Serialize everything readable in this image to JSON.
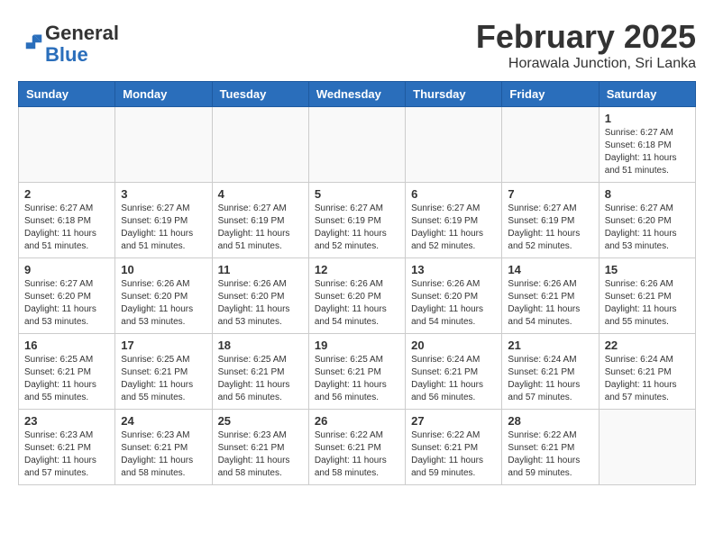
{
  "header": {
    "logo_general": "General",
    "logo_blue": "Blue",
    "title": "February 2025",
    "subtitle": "Horawala Junction, Sri Lanka"
  },
  "weekdays": [
    "Sunday",
    "Monday",
    "Tuesday",
    "Wednesday",
    "Thursday",
    "Friday",
    "Saturday"
  ],
  "weeks": [
    [
      {
        "day": "",
        "info": ""
      },
      {
        "day": "",
        "info": ""
      },
      {
        "day": "",
        "info": ""
      },
      {
        "day": "",
        "info": ""
      },
      {
        "day": "",
        "info": ""
      },
      {
        "day": "",
        "info": ""
      },
      {
        "day": "1",
        "info": "Sunrise: 6:27 AM\nSunset: 6:18 PM\nDaylight: 11 hours\nand 51 minutes."
      }
    ],
    [
      {
        "day": "2",
        "info": "Sunrise: 6:27 AM\nSunset: 6:18 PM\nDaylight: 11 hours\nand 51 minutes."
      },
      {
        "day": "3",
        "info": "Sunrise: 6:27 AM\nSunset: 6:19 PM\nDaylight: 11 hours\nand 51 minutes."
      },
      {
        "day": "4",
        "info": "Sunrise: 6:27 AM\nSunset: 6:19 PM\nDaylight: 11 hours\nand 51 minutes."
      },
      {
        "day": "5",
        "info": "Sunrise: 6:27 AM\nSunset: 6:19 PM\nDaylight: 11 hours\nand 52 minutes."
      },
      {
        "day": "6",
        "info": "Sunrise: 6:27 AM\nSunset: 6:19 PM\nDaylight: 11 hours\nand 52 minutes."
      },
      {
        "day": "7",
        "info": "Sunrise: 6:27 AM\nSunset: 6:19 PM\nDaylight: 11 hours\nand 52 minutes."
      },
      {
        "day": "8",
        "info": "Sunrise: 6:27 AM\nSunset: 6:20 PM\nDaylight: 11 hours\nand 53 minutes."
      }
    ],
    [
      {
        "day": "9",
        "info": "Sunrise: 6:27 AM\nSunset: 6:20 PM\nDaylight: 11 hours\nand 53 minutes."
      },
      {
        "day": "10",
        "info": "Sunrise: 6:26 AM\nSunset: 6:20 PM\nDaylight: 11 hours\nand 53 minutes."
      },
      {
        "day": "11",
        "info": "Sunrise: 6:26 AM\nSunset: 6:20 PM\nDaylight: 11 hours\nand 53 minutes."
      },
      {
        "day": "12",
        "info": "Sunrise: 6:26 AM\nSunset: 6:20 PM\nDaylight: 11 hours\nand 54 minutes."
      },
      {
        "day": "13",
        "info": "Sunrise: 6:26 AM\nSunset: 6:20 PM\nDaylight: 11 hours\nand 54 minutes."
      },
      {
        "day": "14",
        "info": "Sunrise: 6:26 AM\nSunset: 6:21 PM\nDaylight: 11 hours\nand 54 minutes."
      },
      {
        "day": "15",
        "info": "Sunrise: 6:26 AM\nSunset: 6:21 PM\nDaylight: 11 hours\nand 55 minutes."
      }
    ],
    [
      {
        "day": "16",
        "info": "Sunrise: 6:25 AM\nSunset: 6:21 PM\nDaylight: 11 hours\nand 55 minutes."
      },
      {
        "day": "17",
        "info": "Sunrise: 6:25 AM\nSunset: 6:21 PM\nDaylight: 11 hours\nand 55 minutes."
      },
      {
        "day": "18",
        "info": "Sunrise: 6:25 AM\nSunset: 6:21 PM\nDaylight: 11 hours\nand 56 minutes."
      },
      {
        "day": "19",
        "info": "Sunrise: 6:25 AM\nSunset: 6:21 PM\nDaylight: 11 hours\nand 56 minutes."
      },
      {
        "day": "20",
        "info": "Sunrise: 6:24 AM\nSunset: 6:21 PM\nDaylight: 11 hours\nand 56 minutes."
      },
      {
        "day": "21",
        "info": "Sunrise: 6:24 AM\nSunset: 6:21 PM\nDaylight: 11 hours\nand 57 minutes."
      },
      {
        "day": "22",
        "info": "Sunrise: 6:24 AM\nSunset: 6:21 PM\nDaylight: 11 hours\nand 57 minutes."
      }
    ],
    [
      {
        "day": "23",
        "info": "Sunrise: 6:23 AM\nSunset: 6:21 PM\nDaylight: 11 hours\nand 57 minutes."
      },
      {
        "day": "24",
        "info": "Sunrise: 6:23 AM\nSunset: 6:21 PM\nDaylight: 11 hours\nand 58 minutes."
      },
      {
        "day": "25",
        "info": "Sunrise: 6:23 AM\nSunset: 6:21 PM\nDaylight: 11 hours\nand 58 minutes."
      },
      {
        "day": "26",
        "info": "Sunrise: 6:22 AM\nSunset: 6:21 PM\nDaylight: 11 hours\nand 58 minutes."
      },
      {
        "day": "27",
        "info": "Sunrise: 6:22 AM\nSunset: 6:21 PM\nDaylight: 11 hours\nand 59 minutes."
      },
      {
        "day": "28",
        "info": "Sunrise: 6:22 AM\nSunset: 6:21 PM\nDaylight: 11 hours\nand 59 minutes."
      },
      {
        "day": "",
        "info": ""
      }
    ]
  ]
}
